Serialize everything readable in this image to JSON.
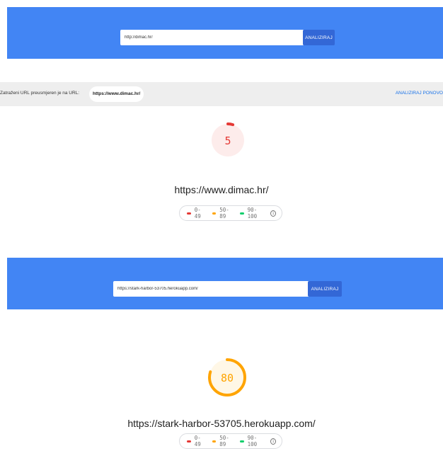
{
  "colors": {
    "header_blue": "#4285f4",
    "button_blue": "#3367d6",
    "fail": "#e53935",
    "fail_bg": "#fdeceb",
    "average": "#ffa400",
    "average_bg": "#fff7e6",
    "pass": "#0cce6b",
    "link": "#1a73e8"
  },
  "section1": {
    "search": {
      "url_value": "http://dimac.hr/",
      "button_label": "ANALIZIRAJ"
    },
    "redirect_notice": {
      "text": "Zatraženi URL preusmjeren je na URL:",
      "url": "https://www.dimac.hr/",
      "reanalyze_label": "ANALIZIRAJ PONOVO"
    },
    "score": {
      "value": "5",
      "fraction": 0.05,
      "rating": "fail"
    },
    "site_url": "https://www.dimac.hr/"
  },
  "section2": {
    "search": {
      "url_value": "https://stark-harbor-53705.herokuapp.com/",
      "button_label": "ANALIZIRAJ"
    },
    "score": {
      "value": "80",
      "fraction": 0.8,
      "rating": "average"
    },
    "site_url": "https://stark-harbor-53705.herokuapp.com/"
  },
  "legend": {
    "items": [
      {
        "label": "0-49",
        "color": "#e53935"
      },
      {
        "label": "50-89",
        "color": "#ffa400"
      },
      {
        "label": "90-100",
        "color": "#0cce6b"
      }
    ],
    "info_icon": "info-icon",
    "info_glyph": "i"
  }
}
